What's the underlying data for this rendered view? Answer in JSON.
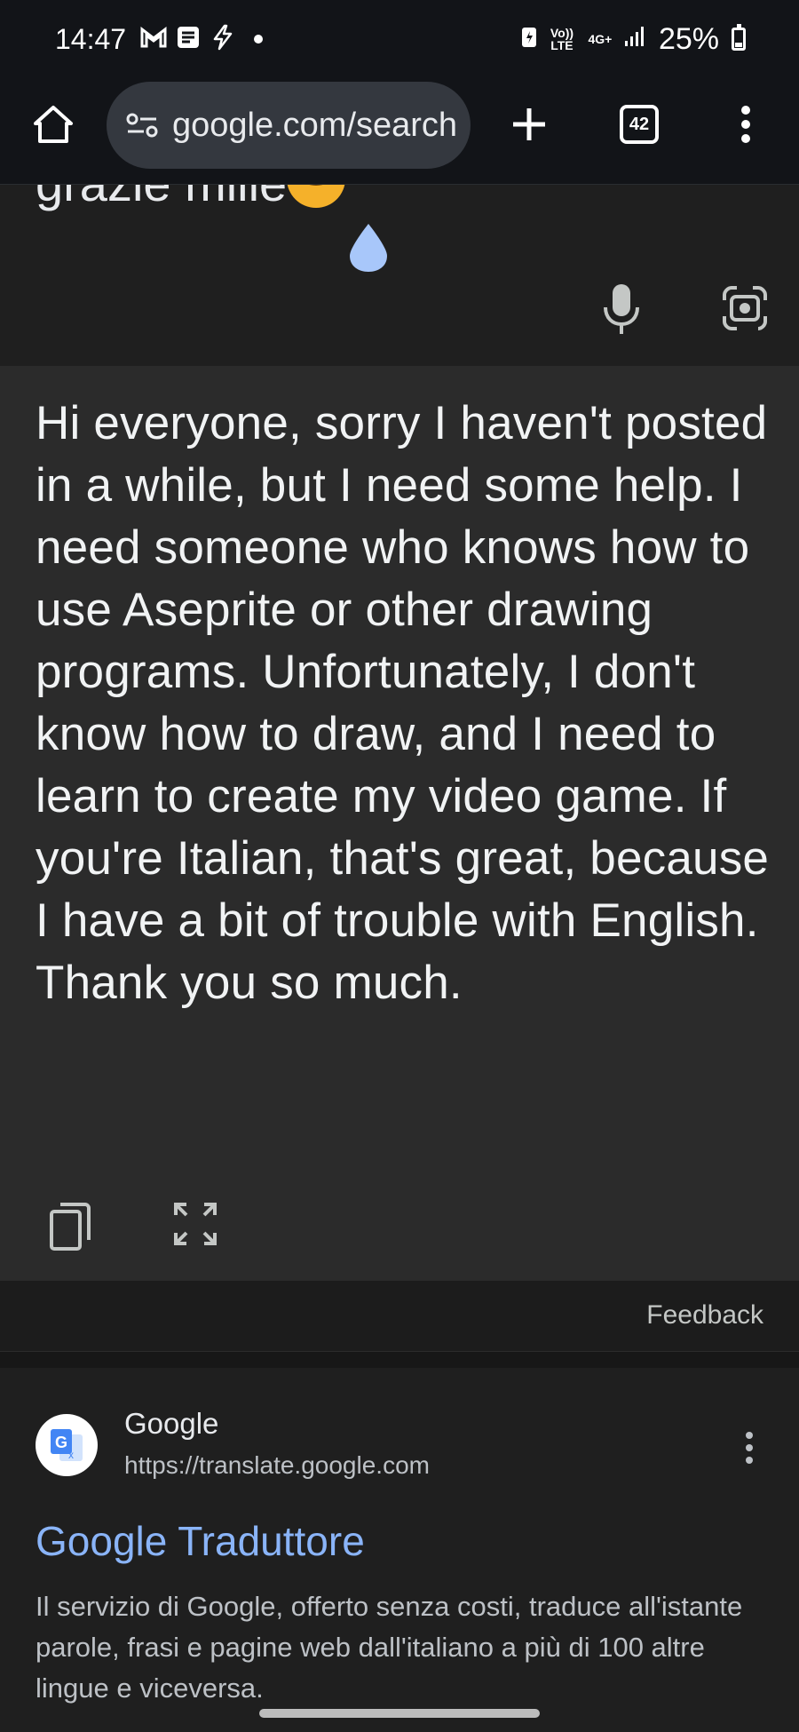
{
  "status_bar": {
    "time": "14:47",
    "net_top": "Vo)) LTE",
    "net_gen": "4G+",
    "battery": "25%",
    "battery_level": 0.25
  },
  "browser": {
    "url": "google.com/search",
    "tab_count": "42"
  },
  "translation": {
    "source_visible": "grazie mille",
    "output": "Hi everyone, sorry I haven't posted in a while, but I need some help. I need someone who knows how to use Aseprite or other drawing programs. Unfortunately, I don't know how to draw, and I need to learn to create my video game. If you're Italian, that's great, because I have a bit of trouble with English. Thank you so much.",
    "feedback": "Feedback"
  },
  "result": {
    "site_name": "Google",
    "site_url": "https://translate.google.com",
    "title": "Google Traduttore",
    "snippet": "Il servizio di Google, offerto senza costi, traduce all'istante parole, frasi e pagine web dall'italiano a più di 100 altre lingue e viceversa."
  },
  "colors": {
    "accent_link": "#8ab4f8",
    "card_bg": "#2b2b2b",
    "page_bg": "#1f1f1f"
  },
  "icons": [
    "gmail-icon",
    "news-icon",
    "bolt-icon",
    "home-icon",
    "site-settings-icon",
    "plus-icon",
    "tab-switcher-icon",
    "more-icon",
    "mic-icon",
    "lens-icon",
    "copy-icon",
    "fullscreen-icon",
    "google-translate-icon"
  ]
}
